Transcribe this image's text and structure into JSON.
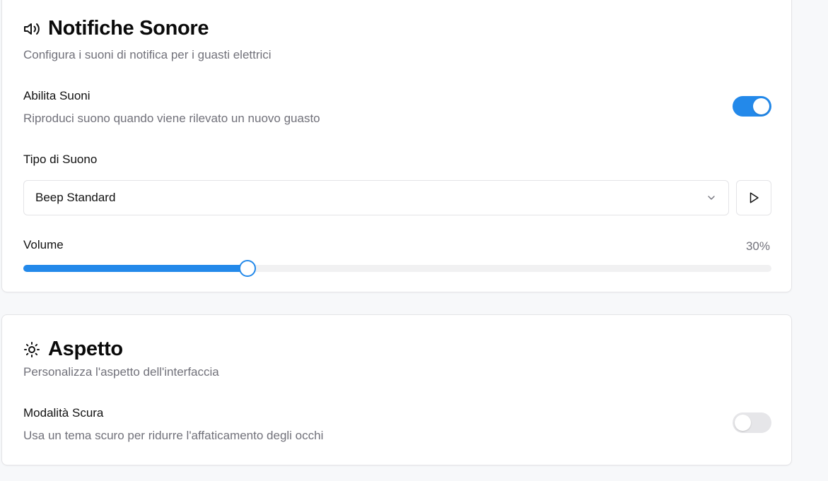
{
  "sound_card": {
    "icon": "speaker-icon",
    "title": "Notifiche Sonore",
    "description": "Configura i suoni di notifica per i guasti elettrici",
    "enable_sounds": {
      "label": "Abilita Suoni",
      "description": "Riproduci suono quando viene rilevato un nuovo guasto",
      "enabled": true
    },
    "sound_type": {
      "label": "Tipo di Suono",
      "selected": "Beep Standard"
    },
    "volume": {
      "label": "Volume",
      "value_text": "30%",
      "value": 30
    }
  },
  "appearance_card": {
    "icon": "sun-icon",
    "title": "Aspetto",
    "description": "Personalizza l'aspetto dell'interfaccia",
    "dark_mode": {
      "label": "Modalità Scura",
      "description": "Usa un tema scuro per ridurre l'affaticamento degli occhi",
      "enabled": false
    }
  },
  "colors": {
    "accent": "#2389ea",
    "muted_text": "#71717a",
    "border": "#e4e4e7"
  }
}
